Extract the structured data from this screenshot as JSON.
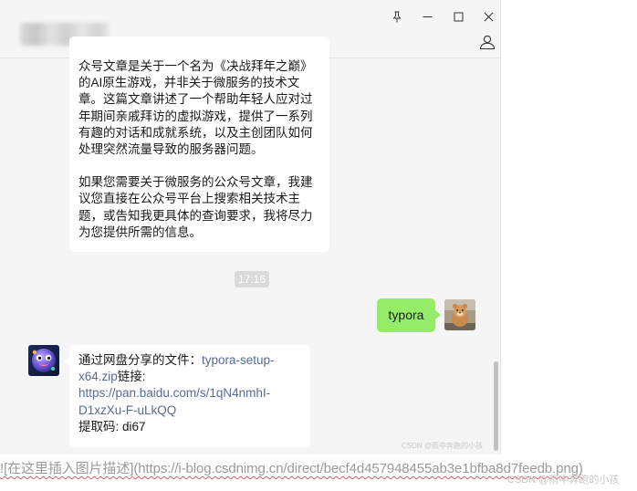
{
  "window": {
    "contact_name": "",
    "buttons": {
      "pin": "pin-icon",
      "minimize": "minimize-icon",
      "maximize": "maximize-icon",
      "close": "close-icon",
      "profile": "person-icon"
    }
  },
  "messages": {
    "bot_reply_1": {
      "para1": "众号文章是关于一个名为《决战拜年之巅》的AI原生游戏，并非关于微服务的技术文章。这篇文章讲述了一个帮助年轻人应对过年期间亲戚拜访的虚拟游戏，提供了一系列有趣的对话和成就系统，以及主创团队如何处理突然流量导致的服务器问题。",
      "para2": "如果您需要关于微服务的公众号文章，我建议您直接在公众号平台上搜索相关技术主题，或告知我更具体的查询要求，我将尽力为您提供所需的信息。"
    },
    "timestamp": "17:16",
    "user_message": "typora",
    "bot_reply_2": {
      "prefix": "通过网盘分享的文件：",
      "file_name_1": "typora-setup-",
      "file_name_2": "x64.zip",
      "link_label": "链接:",
      "url_1": "https://pan.baidu.com/s/1qN4nmhI-",
      "url_2": "D1xzXu-F-uLkQQ",
      "code": " 提取码: di67"
    }
  },
  "watermark_small": "CSDN @雨中奔跑的小孩",
  "markdown_line": {
    "alt": "![在这里插入图片描述]",
    "url": "(https://i-blog.csdnimg.cn/direct/becf4d457948455ab3e1bfba8d7feedb.png)"
  },
  "watermark_bottom": "CSDN @雨中奔跑的小孩",
  "colors": {
    "chat_bg": "#f5f5f5",
    "user_bubble": "#95ec69",
    "link": "#576b95"
  }
}
